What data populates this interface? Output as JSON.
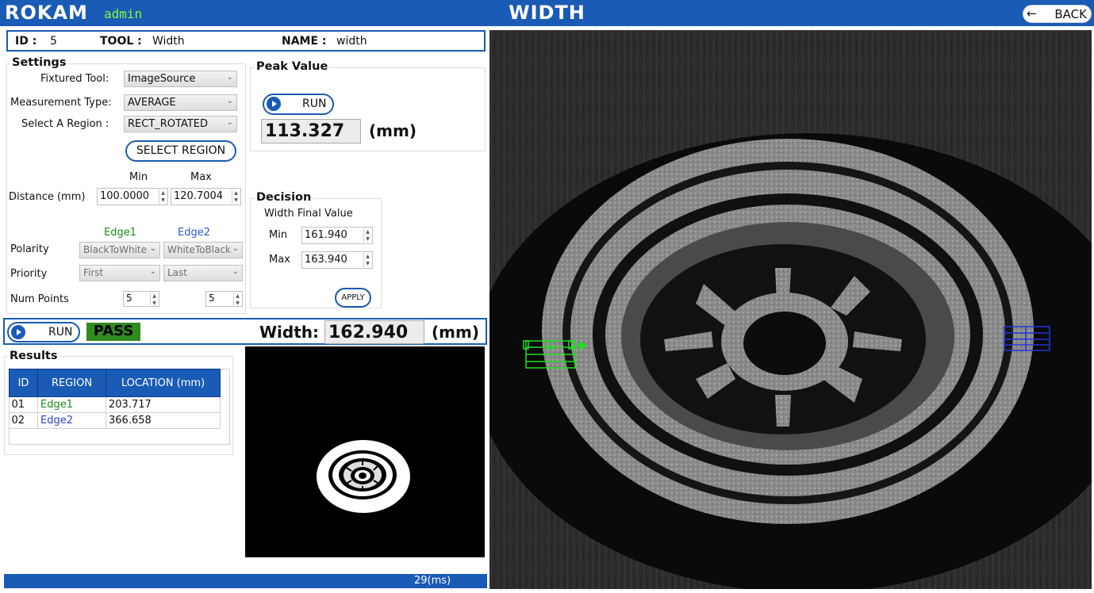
{
  "header": {
    "logo": "ROKAM",
    "user": "admin",
    "title": "WIDTH",
    "back_label": "BACK"
  },
  "info": {
    "id_label": "ID :",
    "id_value": "5",
    "tool_label": "TOOL :",
    "tool_value": "Width",
    "name_label": "NAME :",
    "name_value": "width"
  },
  "settings": {
    "legend": "Settings",
    "fixtured_tool_label": "Fixtured Tool:",
    "fixtured_tool_value": "ImageSource",
    "measurement_type_label": "Measurement Type:",
    "measurement_type_value": "AVERAGE",
    "region_label": "Select A Region :",
    "region_value": "RECT_ROTATED",
    "select_region_button": "SELECT REGION",
    "min_header": "Min",
    "max_header": "Max",
    "distance_label": "Distance (mm)",
    "distance_min": "100.0000",
    "distance_max": "120.7004",
    "edge1_header": "Edge1",
    "edge2_header": "Edge2",
    "polarity_label": "Polarity",
    "polarity_edge1": "BlackToWhite",
    "polarity_edge2": "WhiteToBlack",
    "priority_label": "Priority",
    "priority_edge1": "First",
    "priority_edge2": "Last",
    "num_points_label": "Num Points",
    "num_points_edge1": "5",
    "num_points_edge2": "5"
  },
  "peak": {
    "legend": "Peak Value",
    "run_label": "RUN",
    "value": "113.327",
    "unit": "(mm)"
  },
  "decision": {
    "legend": "Decision",
    "subtitle": "Width Final Value",
    "min_label": "Min",
    "min_value": "161.940",
    "max_label": "Max",
    "max_value": "163.940",
    "apply_label": "APPLY"
  },
  "run_bar": {
    "run_label": "RUN",
    "status": "PASS",
    "width_label": "Width:",
    "width_value": "162.940",
    "unit": "(mm)"
  },
  "results": {
    "legend": "Results",
    "columns": [
      "ID",
      "REGION",
      "LOCATION (mm)"
    ],
    "rows": [
      {
        "id": "01",
        "region": "Edge1",
        "location": "203.717"
      },
      {
        "id": "02",
        "region": "Edge2",
        "location": "366.658"
      }
    ]
  },
  "footer": {
    "elapsed": "29(ms)"
  },
  "colors": {
    "brand_blue": "#1a5bb5",
    "pass_green": "#2e8b1e",
    "edge1_green": "#1a8a1a",
    "edge2_blue": "#2a5bd0",
    "user_green": "#7cfc3a"
  },
  "icons": {
    "back": "arrow-left-icon",
    "run": "play-icon"
  }
}
